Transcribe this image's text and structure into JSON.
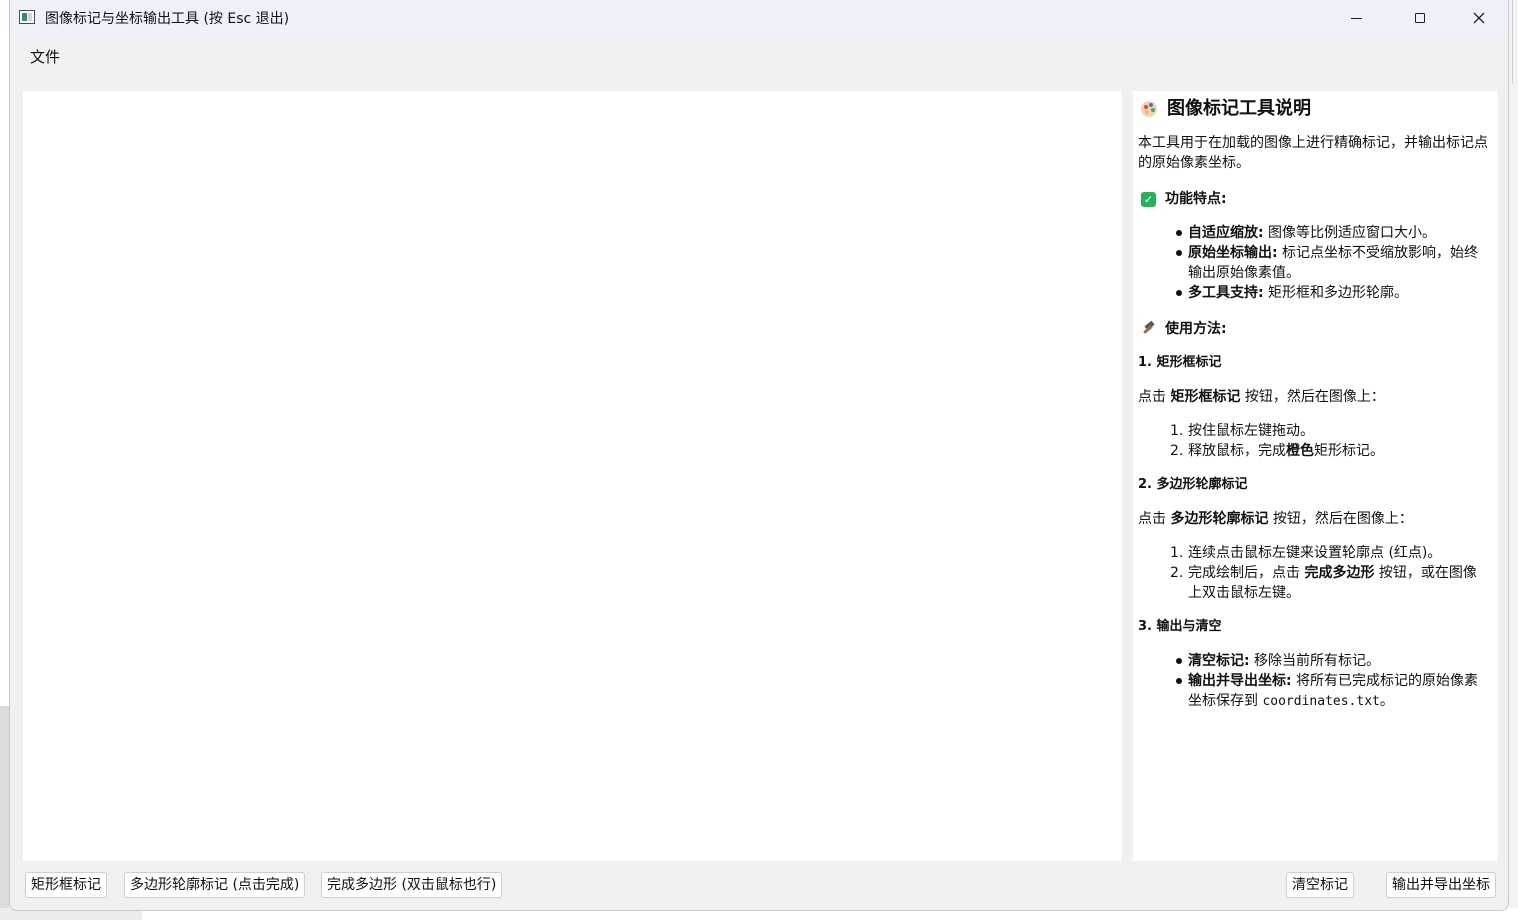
{
  "window": {
    "title": "图像标记与坐标输出工具 (按 Esc 退出)"
  },
  "menu": {
    "file": "文件"
  },
  "doc": {
    "title": "图像标记工具说明",
    "intro": "本工具用于在加载的图像上进行精确标记，并输出标记点的原始像素坐标。",
    "features_head": "功能特点:",
    "features": [
      {
        "label": "自适应缩放:",
        "text": " 图像等比例适应窗口大小。"
      },
      {
        "label": "原始坐标输出:",
        "text": " 标记点坐标不受缩放影响，始终输出原始像素值。"
      },
      {
        "label": "多工具支持:",
        "text": " 矩形框和多边形轮廓。"
      }
    ],
    "usage_head": "使用方法:",
    "rect_head": "1. 矩形框标记",
    "rect_intro_pre": "点击 ",
    "rect_intro_bold": "矩形框标记",
    "rect_intro_post": " 按钮，然后在图像上：",
    "rect_steps": [
      {
        "num": "1.",
        "pre": "按住鼠标左键拖动。",
        "bold": "",
        "post": ""
      },
      {
        "num": "2.",
        "pre": "释放鼠标，完成",
        "bold": "橙色",
        "post": "矩形标记。"
      }
    ],
    "poly_head": "2. 多边形轮廓标记",
    "poly_intro_pre": "点击 ",
    "poly_intro_bold": "多边形轮廓标记",
    "poly_intro_post": " 按钮，然后在图像上：",
    "poly_steps": [
      {
        "num": "1.",
        "pre": "连续点击鼠标左键来设置轮廓点 (红点)。",
        "bold": "",
        "post": ""
      },
      {
        "num": "2.",
        "pre": "完成绘制后，点击 ",
        "bold": "完成多边形",
        "post": " 按钮，或在图像上双击鼠标左键。"
      }
    ],
    "output_head": "3. 输出与清空",
    "output_items": [
      {
        "label": "清空标记:",
        "text": " 移除当前所有标记。",
        "code": "",
        "tail": ""
      },
      {
        "label": "输出并导出坐标:",
        "text": " 将所有已完成标记的原始像素坐标保存到 ",
        "code": "coordinates.txt",
        "tail": "。"
      }
    ]
  },
  "toolbar": {
    "rect": "矩形框标记",
    "poly": "多边形轮廓标记 (点击完成)",
    "finish": "完成多边形 (双击鼠标也行)",
    "clear": "清空标记",
    "export": "输出并导出坐标"
  }
}
